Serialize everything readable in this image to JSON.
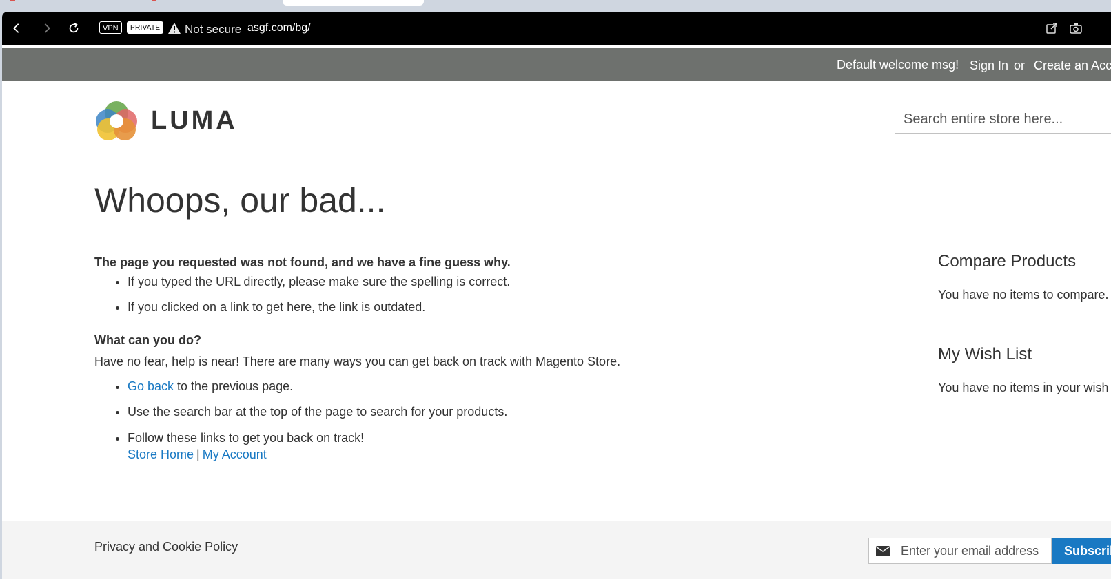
{
  "browser": {
    "vpn_badge": "VPN",
    "private_badge": "PRIVATE",
    "security_text": "Not secure",
    "url": "asgf.com/bg/"
  },
  "header": {
    "welcome": "Default welcome msg!",
    "sign_in": "Sign In",
    "or": "or",
    "create_account": "Create an Account"
  },
  "logo": {
    "text": "LUMA"
  },
  "search": {
    "placeholder": "Search entire store here..."
  },
  "main": {
    "title": "Whoops, our bad...",
    "not_found_heading": "The page you requested was not found, and we have a fine guess why.",
    "reasons": [
      "If you typed the URL directly, please make sure the spelling is correct.",
      "If you clicked on a link to get here, the link is outdated."
    ],
    "what_heading": "What can you do?",
    "help_text": "Have no fear, help is near! There are many ways you can get back on track with Magento Store.",
    "go_back_link": "Go back",
    "go_back_rest": " to the previous page.",
    "search_tip": "Use the search bar at the top of the page to search for your products.",
    "follow_links": "Follow these links to get you back on track!",
    "store_home": "Store Home",
    "separator": "|",
    "my_account": "My Account"
  },
  "sidebar": {
    "compare_title": "Compare Products",
    "compare_text": "You have no items to compare.",
    "wishlist_title": "My Wish List",
    "wishlist_text": "You have no items in your wish list."
  },
  "footer": {
    "privacy": "Privacy and Cookie Policy",
    "email_placeholder": "Enter your email address",
    "subscribe": "Subscribe"
  }
}
